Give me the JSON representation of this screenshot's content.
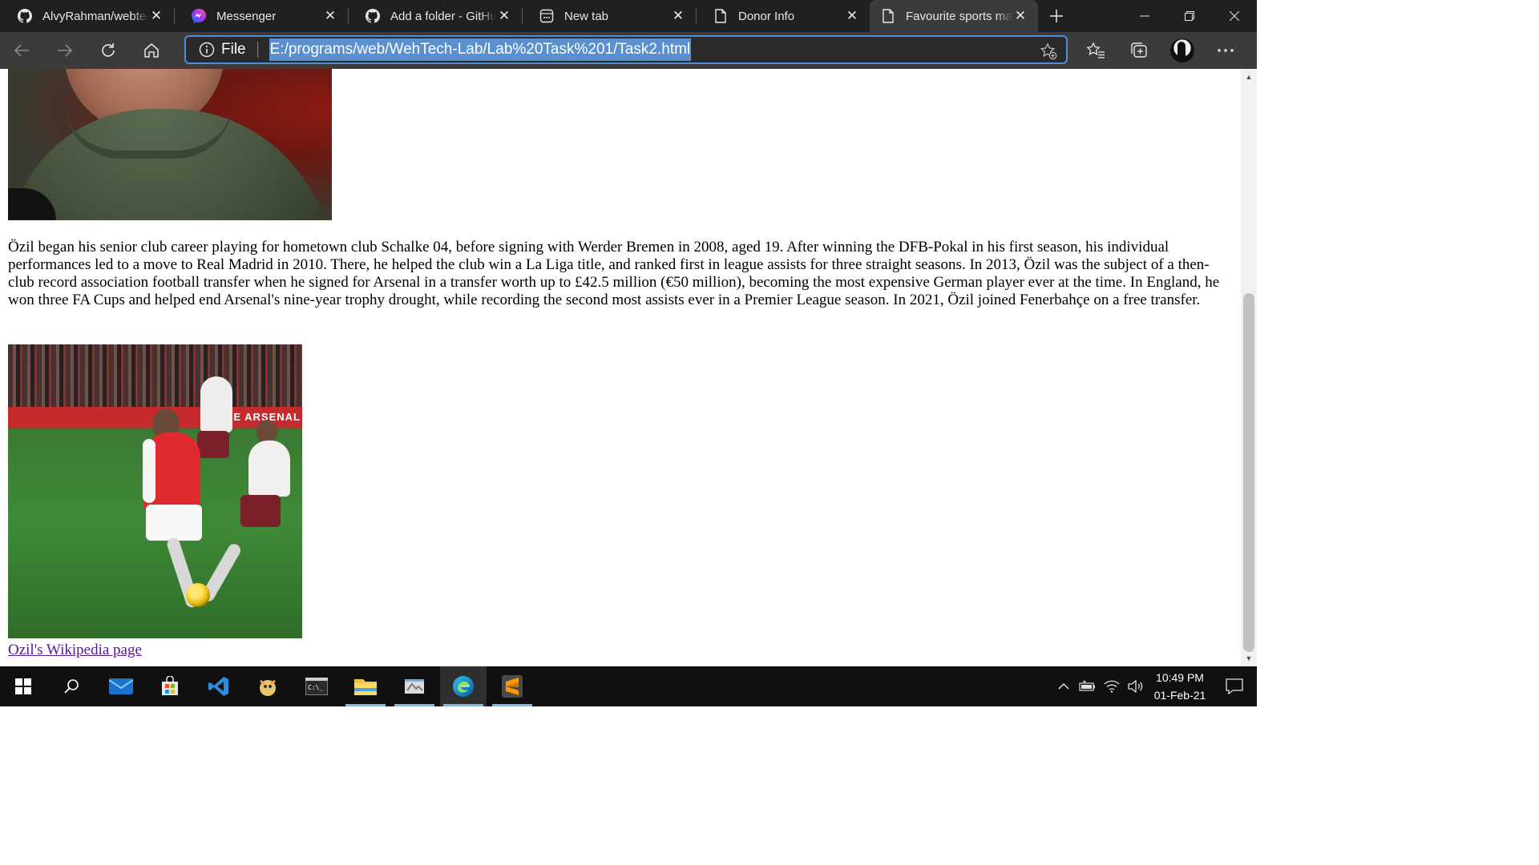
{
  "browser": {
    "tabs": [
      {
        "label": "AlvyRahman/webtech",
        "icon": "github-icon"
      },
      {
        "label": "Messenger",
        "icon": "messenger-icon"
      },
      {
        "label": "Add a folder - GitHub",
        "icon": "github-icon"
      },
      {
        "label": "New tab",
        "icon": "new-tab-icon"
      },
      {
        "label": "Donor Info",
        "icon": "page-icon"
      },
      {
        "label": "Favourite sports man",
        "icon": "page-icon",
        "active": true
      }
    ],
    "address_bar": {
      "scheme_label": "File",
      "url": "E:/programs/web/WehTech-Lab/Lab%20Task%201/Task2.html"
    }
  },
  "page": {
    "paragraph": "Özil began his senior club career playing for hometown club Schalke 04, before signing with Werder Bremen in 2008, aged 19. After winning the DFB-Pokal in his first season, his individual performances led to a move to Real Madrid in 2010. There, he helped the club win a La Liga title, and ranked first in league assists for three straight seasons. In 2013, Özil was the subject of a then-club record association football transfer when he signed for Arsenal in a transfer worth up to £42.5 million (€50 million), becoming the most expensive German player ever at the time. In England, he won three FA Cups and helped end Arsenal's nine-year trophy drought, while recording the second most assists ever in a Premier League season. In 2021, Özil joined Fenerbahçe on a free transfer.",
    "image2_board_text": "HE ARSENAL",
    "link_text": "Ozil's Wikipedia page"
  },
  "taskbar": {
    "apps": [
      "start-icon",
      "search-icon",
      "mail-icon",
      "store-icon",
      "vscode-icon",
      "genshin-icon",
      "terminal-icon",
      "file-explorer-icon",
      "snipping-icon",
      "edge-icon",
      "sublime-icon"
    ],
    "time": "10:49 PM",
    "date": "01-Feb-21"
  },
  "colors": {
    "titlebar": "#202020",
    "toolbar": "#3b3b3b",
    "address_border": "#4f8fd6",
    "url_highlight": "#5a8fd0",
    "link_visited": "#551a8b",
    "taskbar": "#101010"
  }
}
